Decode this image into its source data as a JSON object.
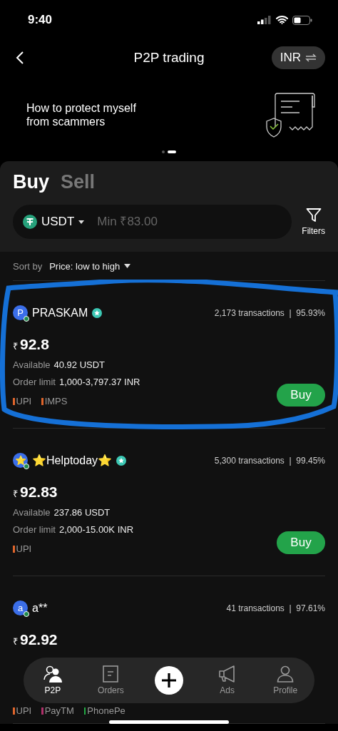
{
  "status_bar": {
    "time": "9:40"
  },
  "header": {
    "title": "P2P trading",
    "currency": "INR"
  },
  "banner": {
    "text": "How to protect myself from scammers",
    "dots": [
      {
        "selected": false
      },
      {
        "selected": true
      }
    ]
  },
  "tabs": [
    {
      "label": "Buy",
      "selected": true
    },
    {
      "label": "Sell",
      "selected": false
    }
  ],
  "filter": {
    "coin": "USDT",
    "placeholder": "Min ₹83.00",
    "filters_label": "Filters"
  },
  "sort": {
    "label": "Sort by",
    "value": "Price: low to high"
  },
  "offers": [
    {
      "avatar": "P",
      "name": "PRASKAM",
      "verified": true,
      "stats": "2,173 transactions  |  95.93%",
      "currency_sign": "₹",
      "price": "92.8",
      "available_label": "Available",
      "available": "40.92 USDT",
      "limit_label": "Order limit",
      "limit": "1,000-3,797.37 INR",
      "methods": [
        {
          "name": "UPI",
          "color": "#e0652b"
        },
        {
          "name": "IMPS",
          "color": "#e0652b"
        }
      ],
      "button": "Buy"
    },
    {
      "avatar": "⭐",
      "name": "⭐Helptoday⭐",
      "verified": true,
      "stats": "5,300 transactions  |  99.45%",
      "currency_sign": "₹",
      "price": "92.83",
      "available_label": "Available",
      "available": "237.86 USDT",
      "limit_label": "Order limit",
      "limit": "2,000-15.00K INR",
      "methods": [
        {
          "name": "UPI",
          "color": "#e0652b"
        }
      ],
      "button": "Buy"
    },
    {
      "avatar": "a",
      "name": "a**",
      "verified": false,
      "stats": "41 transactions  |  97.61%",
      "currency_sign": "₹",
      "price": "92.92",
      "methods": [
        {
          "name": "UPI",
          "color": "#e0652b"
        },
        {
          "name": "PayTM",
          "color": "#b0306a"
        },
        {
          "name": "PhonePe",
          "color": "#22aa44"
        }
      ]
    }
  ],
  "nav": [
    {
      "label": "P2P",
      "selected": true
    },
    {
      "label": "Orders",
      "selected": false
    },
    {
      "selected": false
    },
    {
      "label": "Ads",
      "selected": false
    },
    {
      "label": "Profile",
      "selected": false
    }
  ]
}
